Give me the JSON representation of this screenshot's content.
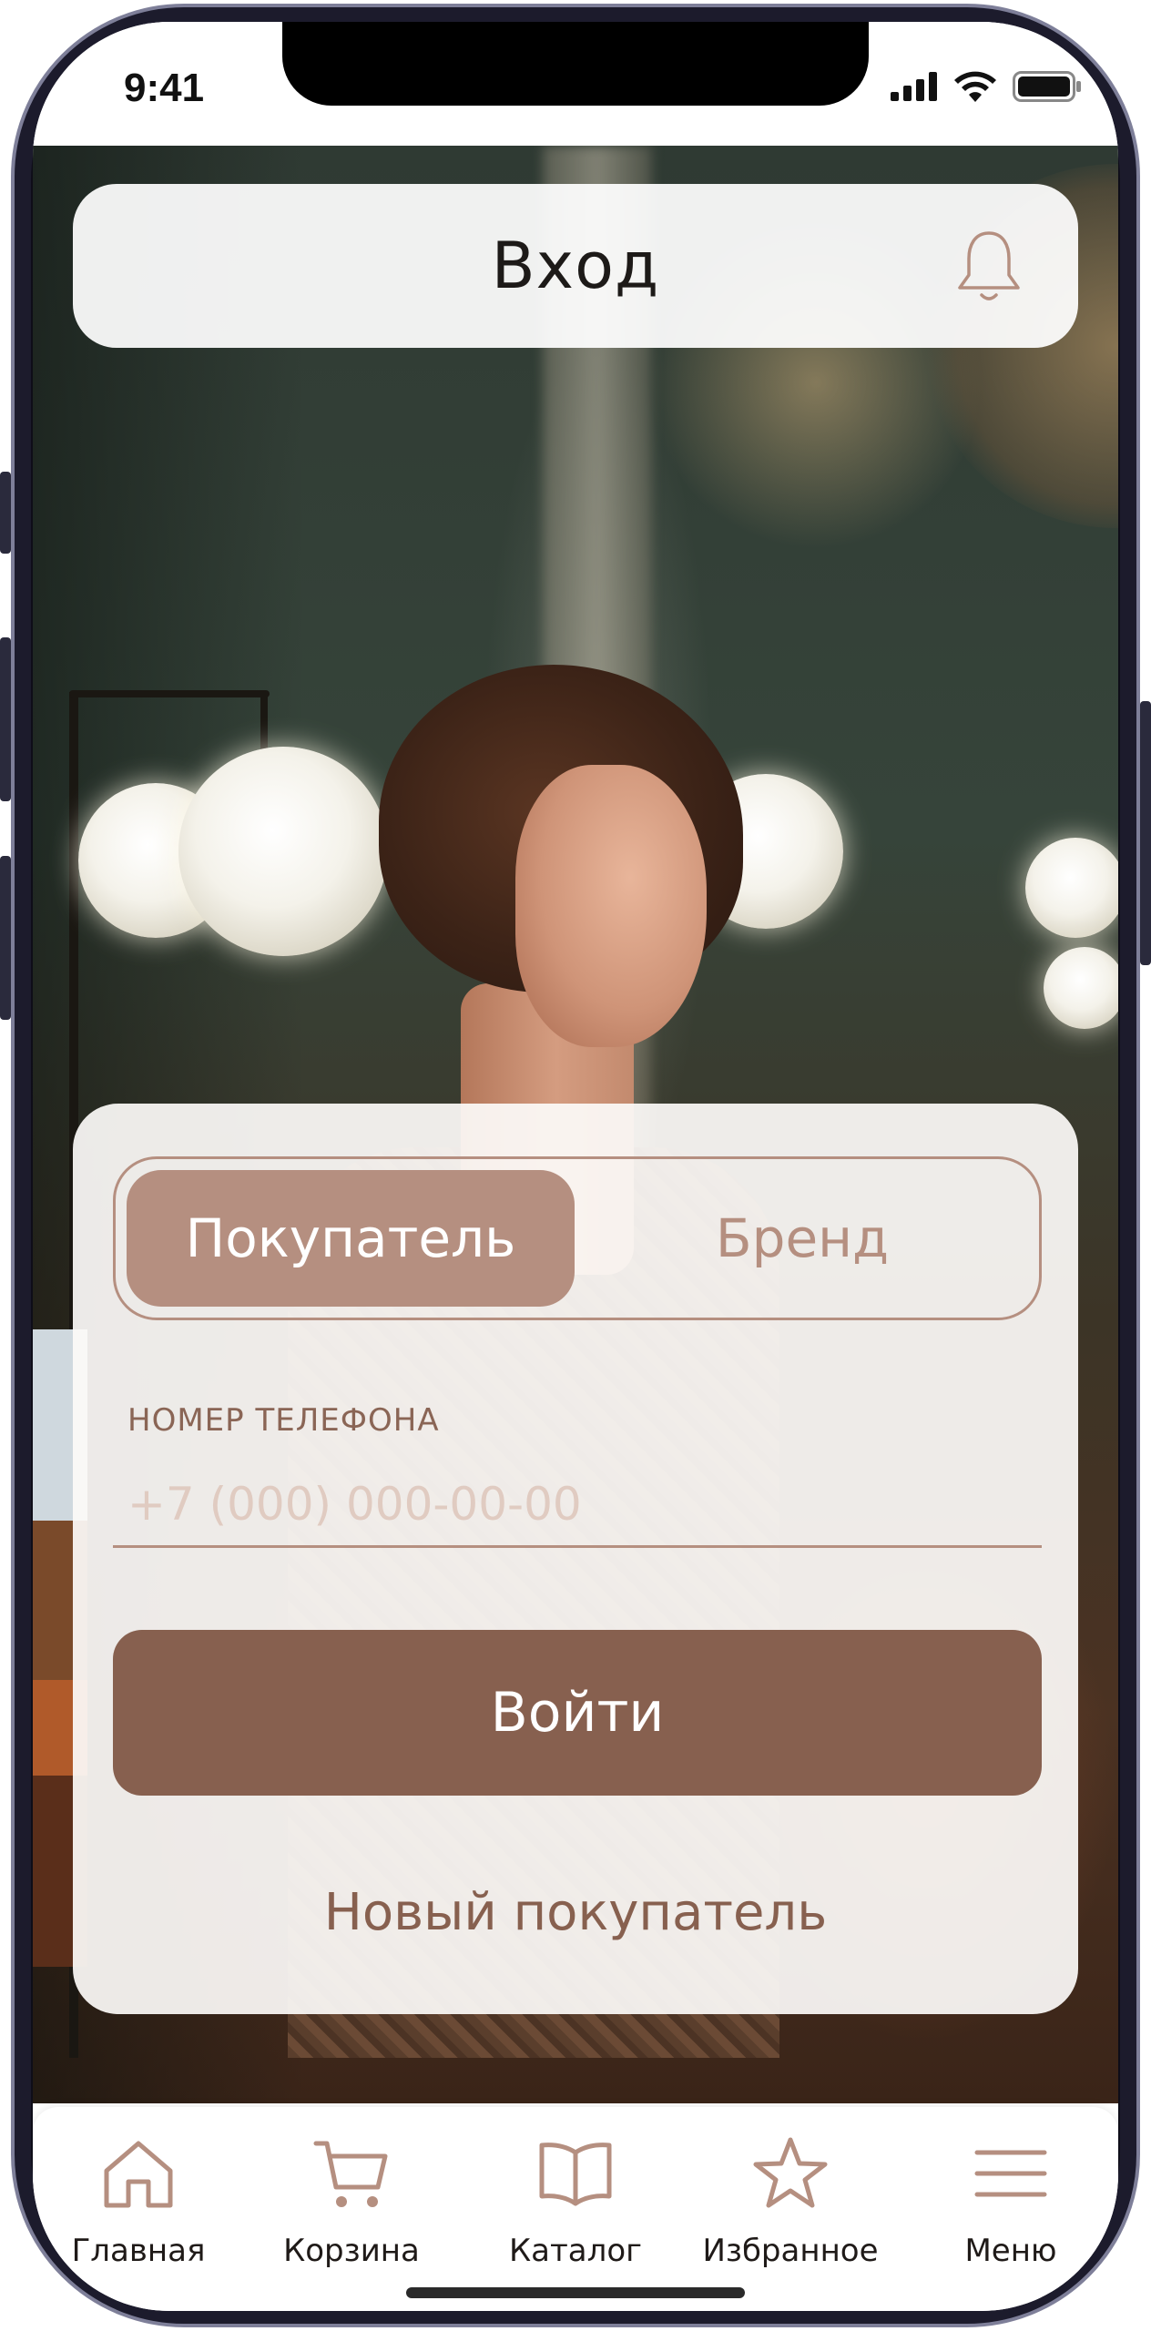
{
  "status_bar": {
    "time": "9:41"
  },
  "header": {
    "title": "Вход",
    "bell_icon": "bell-icon"
  },
  "login": {
    "role_options": [
      "Покупатель",
      "Бренд"
    ],
    "selected_role": "Покупатель",
    "phone_label": "НОМЕР ТЕЛЕФОНА",
    "phone_placeholder": "+7 (000) 000-00-00",
    "phone_value": "",
    "submit_label": "Войти",
    "new_buyer_label": "Новый покупатель"
  },
  "tabbar": {
    "items": [
      {
        "label": "Главная",
        "icon": "home-icon"
      },
      {
        "label": "Корзина",
        "icon": "cart-icon"
      },
      {
        "label": "Каталог",
        "icon": "book-icon"
      },
      {
        "label": "Избранное",
        "icon": "star-icon"
      },
      {
        "label": "Меню",
        "icon": "menu-icon"
      }
    ]
  },
  "colors": {
    "accent": "#b58f80",
    "button": "#87604f",
    "label": "#8a6555",
    "placeholder": "#e0cbc1"
  }
}
